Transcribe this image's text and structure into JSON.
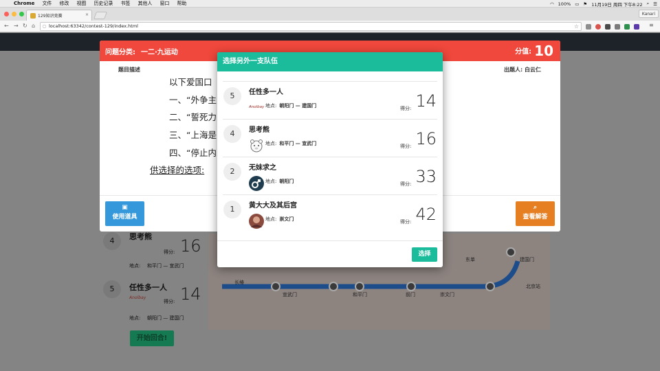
{
  "os_menu": {
    "app": "Chrome",
    "items": [
      "文件",
      "修改",
      "视图",
      "历史记录",
      "书签",
      "其他人",
      "窗口",
      "帮助"
    ],
    "battery": "100%",
    "clock": "11月19日 周四 下午8:22"
  },
  "browser": {
    "tab_title": "129知识竞赛",
    "profile": "Kanari",
    "url": "localhost:63342/contest-129/index.html"
  },
  "question": {
    "category_label": "问题分类:",
    "category": "一二·九运动",
    "points_label": "分值:",
    "points": "10",
    "desc_label": "题目描述",
    "author_label": "出题人:",
    "author": "白云仁",
    "lines": [
      "以下爱国口",
      "一、“外争主",
      "二、“誓死力",
      "三、“上海是",
      "四、“停止内"
    ],
    "options_label": "供选择的选项: ",
    "tool_button": "使用道具",
    "answer_button": "查看解答"
  },
  "team_dialog": {
    "title": "选择另外一支队伍",
    "location_label": "地点:",
    "score_label": "得分:",
    "teams": [
      {
        "rank": "5",
        "name": "任性多一人",
        "location": "朝阳门 — 建国门",
        "score": "14",
        "avatar": "Anolbay"
      },
      {
        "rank": "4",
        "name": "思考熊",
        "location": "和平门 — 宣武门",
        "score": "16",
        "avatar": "bear"
      },
      {
        "rank": "2",
        "name": "无妹求之",
        "location": "朝阳门",
        "score": "33",
        "avatar": "male-symbol"
      },
      {
        "rank": "1",
        "name": "黄大大及其后宫",
        "location": "崇文门",
        "score": "42",
        "avatar": "photo"
      }
    ],
    "choose_button": "选择"
  },
  "background_board": {
    "rows": [
      {
        "rank": "4",
        "name": "思考熊",
        "score": "16",
        "location": "和平门 — 宣武门",
        "score_label": "得分:",
        "location_label": "地点:"
      },
      {
        "rank": "5",
        "name": "任性多一人",
        "score": "14",
        "location": "朝阳门 — 建国门",
        "score_label": "得分:",
        "location_label": "地点:",
        "avatar": "Anolbay"
      }
    ],
    "start_button": "开始回合!",
    "stations": [
      "东单",
      "建国门",
      "长椿",
      "宣武门",
      "和平门",
      "前门",
      "崇文门",
      "北京站"
    ]
  }
}
